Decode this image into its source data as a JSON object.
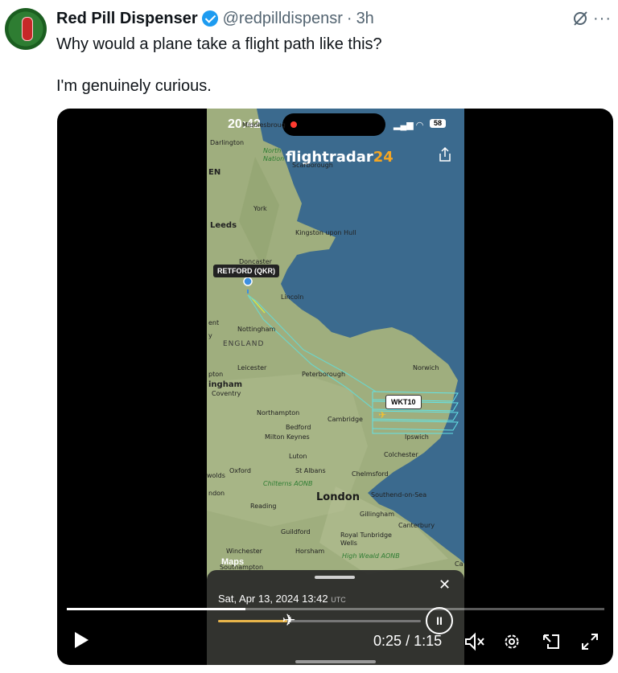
{
  "post": {
    "author_name": "Red Pill Dispenser",
    "handle": "@redpilldispensr",
    "separator": "·",
    "time_ago": "3h",
    "text": "Why would a plane take a flight path like this?\n\nI'm genuinely curious."
  },
  "icons": {
    "verified": "verified-badge-icon",
    "grok": "grok-icon",
    "more": "more-icon"
  },
  "video": {
    "progress_fraction": 0.333,
    "current_time": "0:25",
    "time_separator": "/",
    "duration": "1:15",
    "controls": [
      "play-icon",
      "mute-icon",
      "settings-icon",
      "pip-icon",
      "fullscreen-icon"
    ]
  },
  "phone": {
    "clock": "20:42",
    "battery": "58",
    "app_brand_text": "flightradar",
    "app_brand_num": "24",
    "airport_tag": "RETFORD (QKR)",
    "flight_tag": "WKT10",
    "maps_logo": "Maps",
    "sheet": {
      "date": "Sat, Apr 13, 2024",
      "time": "13:42",
      "tz": "UTC",
      "close": "✕",
      "scrub_fraction": 0.34
    },
    "map_labels": {
      "middlesbrough": "Middlesbroug",
      "darlington": "Darlington",
      "north": "North",
      "national": "Nation",
      "scarborough": "Scarborough",
      "en": "EN",
      "york": "York",
      "leeds": "Leeds",
      "kingston": "Kingston upon Hull",
      "doncaster": "Doncaster",
      "lincoln": "Lincoln",
      "ent": "ent",
      "y": "y",
      "nottingham": "Nottingham",
      "england": "ENGLAND",
      "norwich": "Norwich",
      "leicester": "Leicester",
      "pton": "pton",
      "peterborough": "Peterborough",
      "ingham": "ingham",
      "coventry": "Coventry",
      "northampton": "Northampton",
      "cambridge": "Cambridge",
      "bedford": "Bedford",
      "milton_keynes": "Milton Keynes",
      "ipswich": "Ipswich",
      "colchester": "Colchester",
      "luton": "Luton",
      "oxford": "Oxford",
      "st_albans": "St Albans",
      "chelmsford": "Chelmsford",
      "wolds": "wolds",
      "chilterns": "Chilterns AONB",
      "ndon": "ndon",
      "london": "London",
      "southend": "Southend-on-Sea",
      "reading": "Reading",
      "gillingham": "Gillingham",
      "canterbury": "Canterbury",
      "guildford": "Guildford",
      "royal_tunbridge": "Royal Tunbridge",
      "wells": "Wells",
      "winchester": "Winchester",
      "horsham": "Horsham",
      "high_weald": "High Weald AONB",
      "southampton": "Southampton",
      "ca": "Ca"
    }
  }
}
